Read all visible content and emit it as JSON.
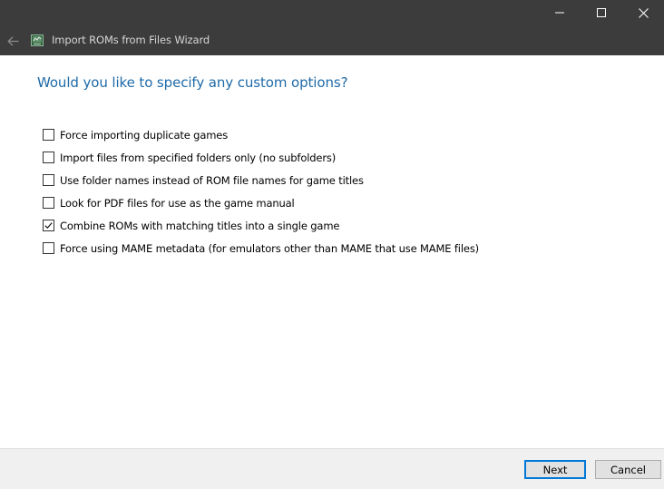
{
  "window": {
    "title": "Import ROMs from Files Wizard",
    "controls": [
      "minimize",
      "maximize",
      "close"
    ]
  },
  "page": {
    "question": "Would you like to specify any custom options?"
  },
  "options": [
    {
      "label": "Force importing duplicate games",
      "checked": false
    },
    {
      "label": "Import files from specified folders only (no subfolders)",
      "checked": false
    },
    {
      "label": "Use folder names instead of ROM file names for game titles",
      "checked": false
    },
    {
      "label": "Look for PDF files for use as the game manual",
      "checked": false
    },
    {
      "label": "Combine ROMs with matching titles into a single game",
      "checked": true
    },
    {
      "label": "Force using MAME metadata (for emulators other than MAME that use MAME files)",
      "checked": false
    }
  ],
  "footer": {
    "next_label": "Next",
    "cancel_label": "Cancel"
  },
  "colors": {
    "titlebar": "#3c3c3c",
    "question": "#1e6aa8",
    "default_button_border": "#0078d7"
  },
  "icons": {
    "back": "arrow-left-icon",
    "app": "app-icon",
    "minimize": "minimize-icon",
    "maximize": "maximize-icon",
    "close": "close-icon",
    "check": "checkmark-icon"
  }
}
